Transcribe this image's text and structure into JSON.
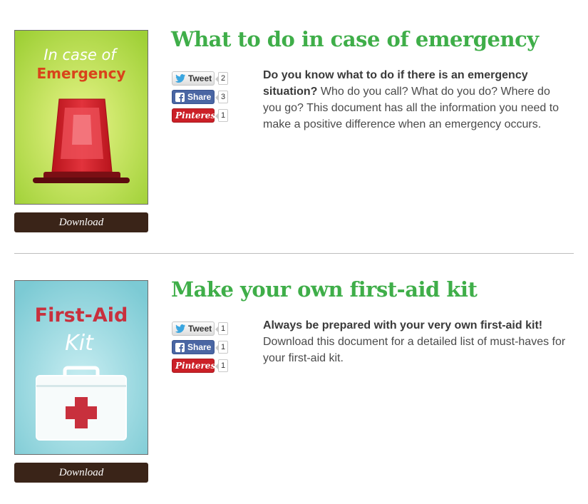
{
  "colors": {
    "title_green": "#3fae49",
    "download_bg": "#3a2418",
    "facebook_blue": "#4a66a3",
    "pinterest_red": "#cb2027"
  },
  "documents": [
    {
      "title": "What to do in case of emergency",
      "cover": {
        "line1": "In case of",
        "line2": "Emergency",
        "icon": "emergency-siren-icon"
      },
      "download_label": "Download",
      "share": {
        "tweet_label": "Tweet",
        "tweet_count": "2",
        "facebook_label": "Share",
        "facebook_count": "3",
        "pinterest_label": "Pinterest",
        "pinterest_count": "1"
      },
      "lead": "Do you know what to do if there is an emergency situation?",
      "body": " Who do you call? What do you do? Where do you go? This document has all the information you need to make a positive difference when an emergency occurs."
    },
    {
      "title": "Make your own first-aid kit",
      "cover": {
        "line1": "First-Aid",
        "line2": "Kit",
        "icon": "first-aid-kit-icon"
      },
      "download_label": "Download",
      "share": {
        "tweet_label": "Tweet",
        "tweet_count": "1",
        "facebook_label": "Share",
        "facebook_count": "1",
        "pinterest_label": "Pinterest",
        "pinterest_count": "1"
      },
      "lead": "Always be prepared with your very own first-aid kit!",
      "body": " Download this document for a detailed list of must-haves for your first-aid kit."
    }
  ]
}
